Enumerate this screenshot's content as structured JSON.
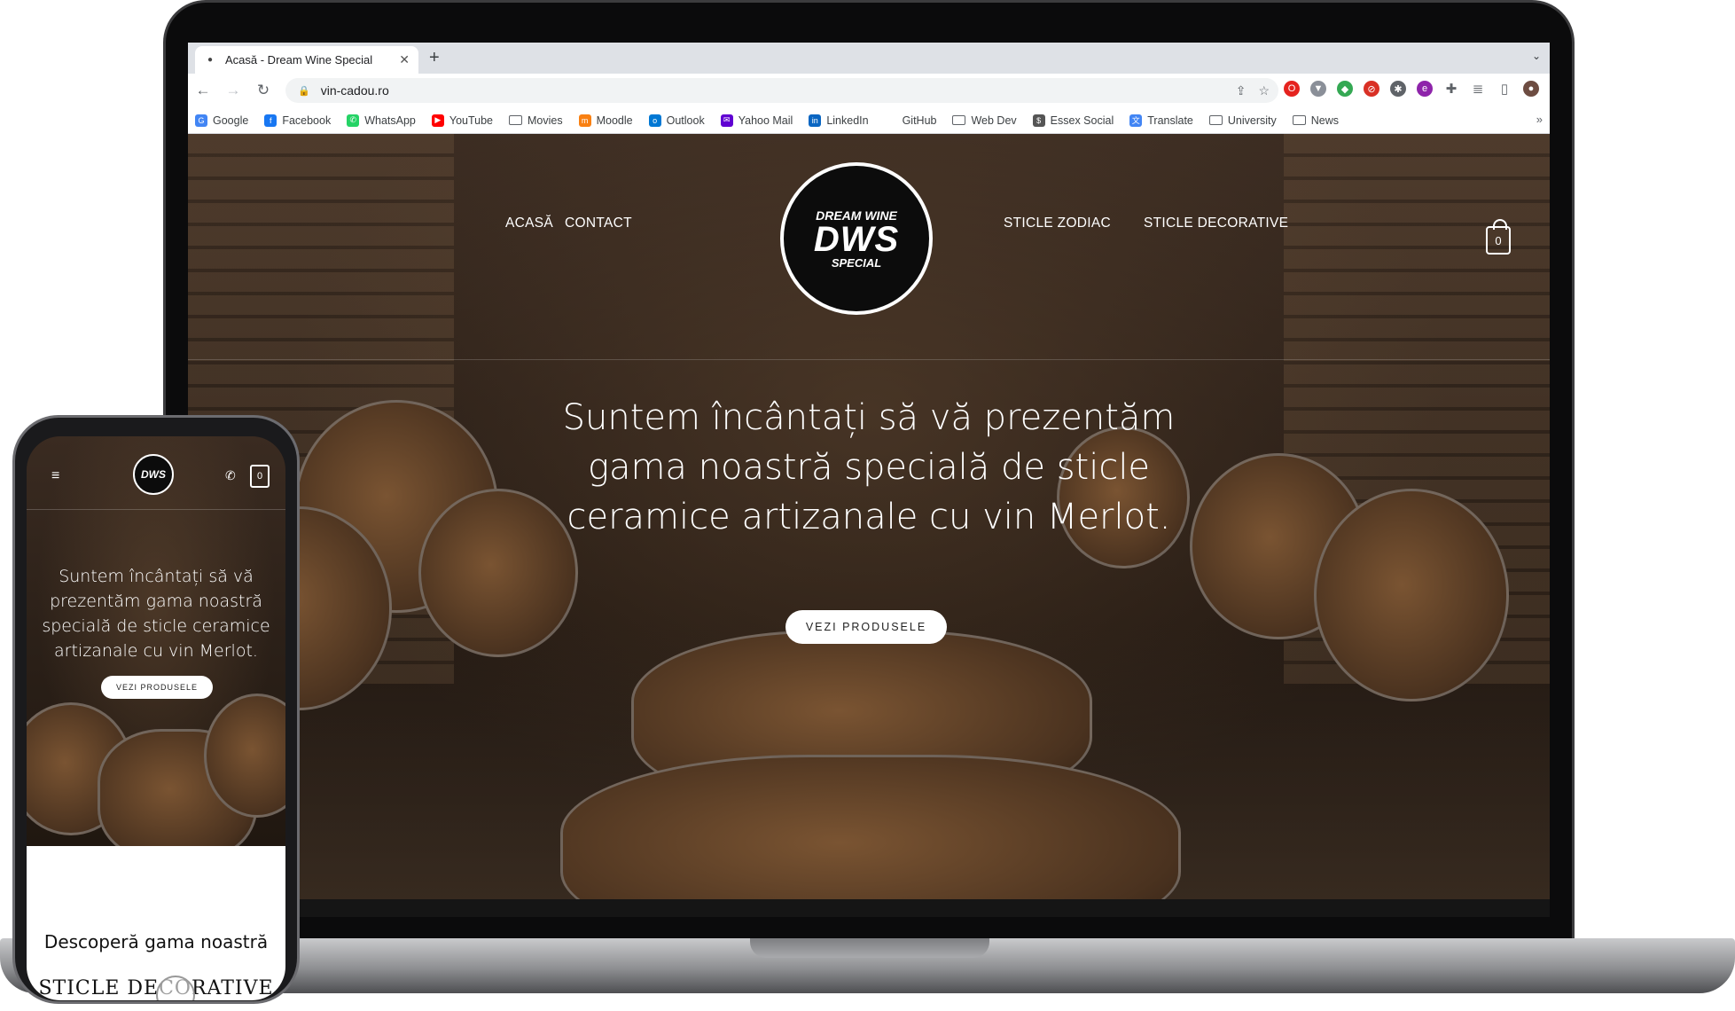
{
  "browser": {
    "tab_title": "Acasă - Dream Wine Special",
    "tab_close": "✕",
    "new_tab": "+",
    "url": "vin-cadou.ro",
    "bookmarks": [
      {
        "label": "Google",
        "color": "#4285f4",
        "glyph": "G"
      },
      {
        "label": "Facebook",
        "color": "#1877f2",
        "glyph": "f"
      },
      {
        "label": "WhatsApp",
        "color": "#25d366",
        "glyph": "✆"
      },
      {
        "label": "YouTube",
        "color": "#ff0000",
        "glyph": "▶"
      },
      {
        "label": "Movies",
        "folder": true
      },
      {
        "label": "Moodle",
        "color": "#f98012",
        "glyph": "m"
      },
      {
        "label": "Outlook",
        "color": "#0078d4",
        "glyph": "o"
      },
      {
        "label": "Yahoo Mail",
        "color": "#6001d2",
        "glyph": "✉"
      },
      {
        "label": "LinkedIn",
        "color": "#0a66c2",
        "glyph": "in"
      },
      {
        "label": "GitHub",
        "color": "#ffffff",
        "glyph": ""
      },
      {
        "label": "Web Dev",
        "folder": true
      },
      {
        "label": "Essex Social",
        "color": "#555555",
        "glyph": "$"
      },
      {
        "label": "Translate",
        "color": "#4285f4",
        "glyph": "文"
      },
      {
        "label": "University",
        "folder": true
      },
      {
        "label": "News",
        "folder": true
      }
    ],
    "more_bookmarks": "»"
  },
  "site": {
    "nav_left": [
      "ACASĂ",
      "CONTACT"
    ],
    "nav_right": [
      "STICLE ZODIAC",
      "STICLE DECORATIVE"
    ],
    "logo": {
      "line1": "DREAM WINE",
      "line2": "DWS",
      "line3": "SPECIAL"
    },
    "cart_count": "0",
    "headline": "Suntem încântați să vă prezentăm gama noastră specială de sticle ceramice artizanale cu vin Merlot.",
    "cta": "VEZI PRODUSELE"
  },
  "mobile": {
    "menu_glyph": "≡",
    "logo": "DWS",
    "phone_glyph": "✆",
    "cart_count": "0",
    "headline": "Suntem încântați să vă prezentăm gama noastră specială de sticle ceramice artizanale cu vin Merlot.",
    "cta": "VEZI PRODUSELE",
    "section_title": "Descoperă gama noastră",
    "sticle_label": "STICLE DECORATIVE"
  }
}
